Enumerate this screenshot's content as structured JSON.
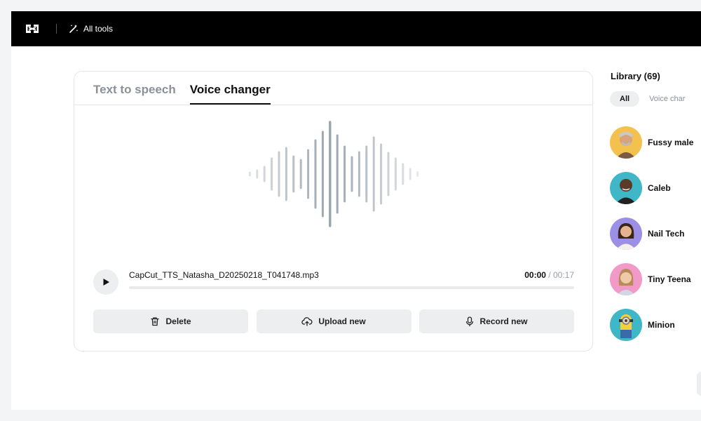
{
  "topbar": {
    "all_tools_label": "All tools"
  },
  "tabs": [
    {
      "label": "Text to speech",
      "active": false
    },
    {
      "label": "Voice changer",
      "active": true
    }
  ],
  "player": {
    "file_name": "CapCut_TTS_Natasha_D20250218_T041748.mp3",
    "current_time": "00:00",
    "separator": "/",
    "duration": "00:17",
    "progress_fraction": 0
  },
  "actions": {
    "delete_label": "Delete",
    "upload_label": "Upload new",
    "record_label": "Record new"
  },
  "library": {
    "title": "Library (69)",
    "filters": [
      {
        "label": "All",
        "active": true
      },
      {
        "label": "Voice char",
        "active": false
      }
    ],
    "voices": [
      {
        "name": "Fussy male",
        "avatar_bg": "#f2c14e"
      },
      {
        "name": "Caleb",
        "avatar_bg": "#3fb7c6"
      },
      {
        "name": "Nail Tech",
        "avatar_bg": "#9b8fe6"
      },
      {
        "name": "Tiny Teena",
        "avatar_bg": "#f29ac7"
      },
      {
        "name": "Minion",
        "avatar_bg": "#3fb7c6"
      }
    ]
  },
  "colors": {
    "topbar": "#000000",
    "button_bg": "#eceef0",
    "wave": "#9aa4ae",
    "inactive_text": "#8a9199"
  },
  "icons": [
    "capcut-logo-icon",
    "magic-wand-icon",
    "play-icon",
    "trash-icon",
    "cloud-upload-icon",
    "microphone-icon"
  ]
}
